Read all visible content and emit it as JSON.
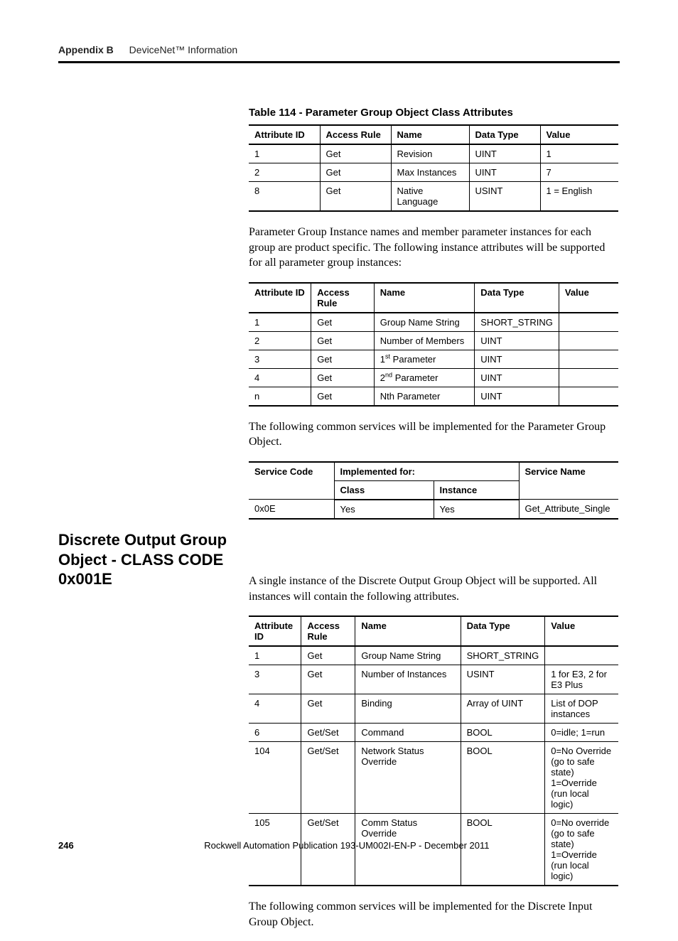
{
  "header": {
    "appendix": "Appendix B",
    "title": "DeviceNet™ Information"
  },
  "table1": {
    "caption": "Table 114 - Parameter Group Object Class Attributes",
    "headers": [
      "Attribute ID",
      "Access Rule",
      "Name",
      "Data Type",
      "Value"
    ],
    "rows": [
      [
        "1",
        "Get",
        "Revision",
        "UINT",
        "1"
      ],
      [
        "2",
        "Get",
        "Max Instances",
        "UINT",
        "7"
      ],
      [
        "8",
        "Get",
        "Native Language",
        "USINT",
        "1 = English"
      ]
    ]
  },
  "para1": "Parameter Group Instance names and member parameter instances for each group are product specific.  The following instance attributes will be supported for all parameter group instances:",
  "table2": {
    "headers": [
      "Attribute ID",
      "Access Rule",
      "Name",
      "Data Type",
      "Value"
    ],
    "rows": [
      [
        "1",
        "Get",
        "Group Name String",
        "SHORT_STRING",
        ""
      ],
      [
        "2",
        "Get",
        "Number of Members",
        "UINT",
        ""
      ],
      [
        "3",
        "Get",
        "1st Parameter",
        "UINT",
        ""
      ],
      [
        "4",
        "Get",
        "2nd Parameter",
        "UINT",
        ""
      ],
      [
        "n",
        "Get",
        "Nth Parameter",
        "UINT",
        ""
      ]
    ],
    "name_html": [
      "Group Name String",
      "Number of Members",
      "1<sup>st</sup> Parameter",
      "2<sup>nd</sup> Parameter",
      "Nth Parameter"
    ]
  },
  "para2": "The following common services will be implemented for the Parameter Group Object.",
  "table3": {
    "headers_top": [
      "Service Code",
      "Implemented for:",
      "Service Name"
    ],
    "headers_sub": [
      "Class",
      "Instance"
    ],
    "rows": [
      [
        "0x0E",
        "Yes",
        "Yes",
        "Get_Attribute_Single"
      ]
    ]
  },
  "section_heading": "Discrete Output Group Object  -  CLASS CODE 0x001E",
  "para3": "A single instance of the Discrete Output Group Object will be supported.  All instances will contain the following attributes.",
  "table4": {
    "headers": [
      "Attribute ID",
      "Access Rule",
      "Name",
      "Data Type",
      "Value"
    ],
    "rows": [
      [
        "1",
        "Get",
        "Group Name String",
        "SHORT_STRING",
        ""
      ],
      [
        "3",
        "Get",
        "Number of Instances",
        "USINT",
        "1 for E3,  2 for E3 Plus"
      ],
      [
        "4",
        "Get",
        "Binding",
        "Array of UINT",
        "List of DOP instances"
      ],
      [
        "6",
        "Get/Set",
        "Command",
        "BOOL",
        "0=idle;  1=run"
      ],
      [
        "104",
        "Get/Set",
        "Network Status Override",
        "BOOL",
        "0=No Override (go to safe state)\n1=Override (run local logic)"
      ],
      [
        "105",
        "Get/Set",
        "Comm Status Override",
        "BOOL",
        "0=No override (go to safe state)\n1=Override (run local logic)"
      ]
    ]
  },
  "para4": "The following common services will be implemented for the Discrete Input Group Object.",
  "footer": {
    "page": "246",
    "pub": "Rockwell Automation Publication 193-UM002I-EN-P - December 2011"
  }
}
